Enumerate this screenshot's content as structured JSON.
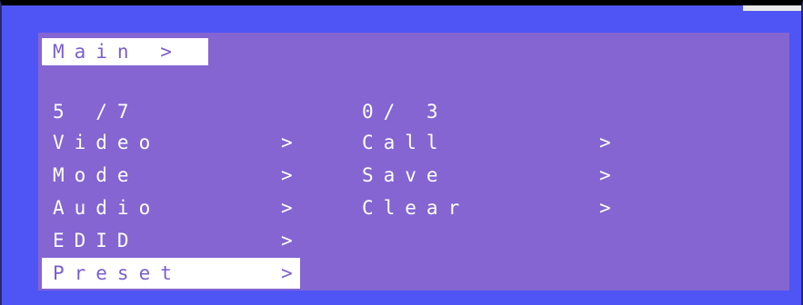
{
  "breadcrumb": "Main >",
  "left_column": {
    "counter": "5 /7",
    "items": [
      {
        "label": "Video",
        "arrow": ">"
      },
      {
        "label": "Mode",
        "arrow": ">"
      },
      {
        "label": "Audio",
        "arrow": ">"
      },
      {
        "label": "EDID",
        "arrow": ">"
      },
      {
        "label": "Preset",
        "arrow": ">",
        "selected": true
      }
    ]
  },
  "right_column": {
    "counter": "0/ 3",
    "items": [
      {
        "label": "Call",
        "arrow": ">"
      },
      {
        "label": "Save",
        "arrow": ">"
      },
      {
        "label": "Clear",
        "arrow": ">"
      }
    ]
  },
  "colors": {
    "frame": "#4f55f5",
    "panel": "#8465d2",
    "highlight_bg": "#ffffff",
    "highlight_text": "#7b5fd0",
    "text": "#ffffff"
  }
}
